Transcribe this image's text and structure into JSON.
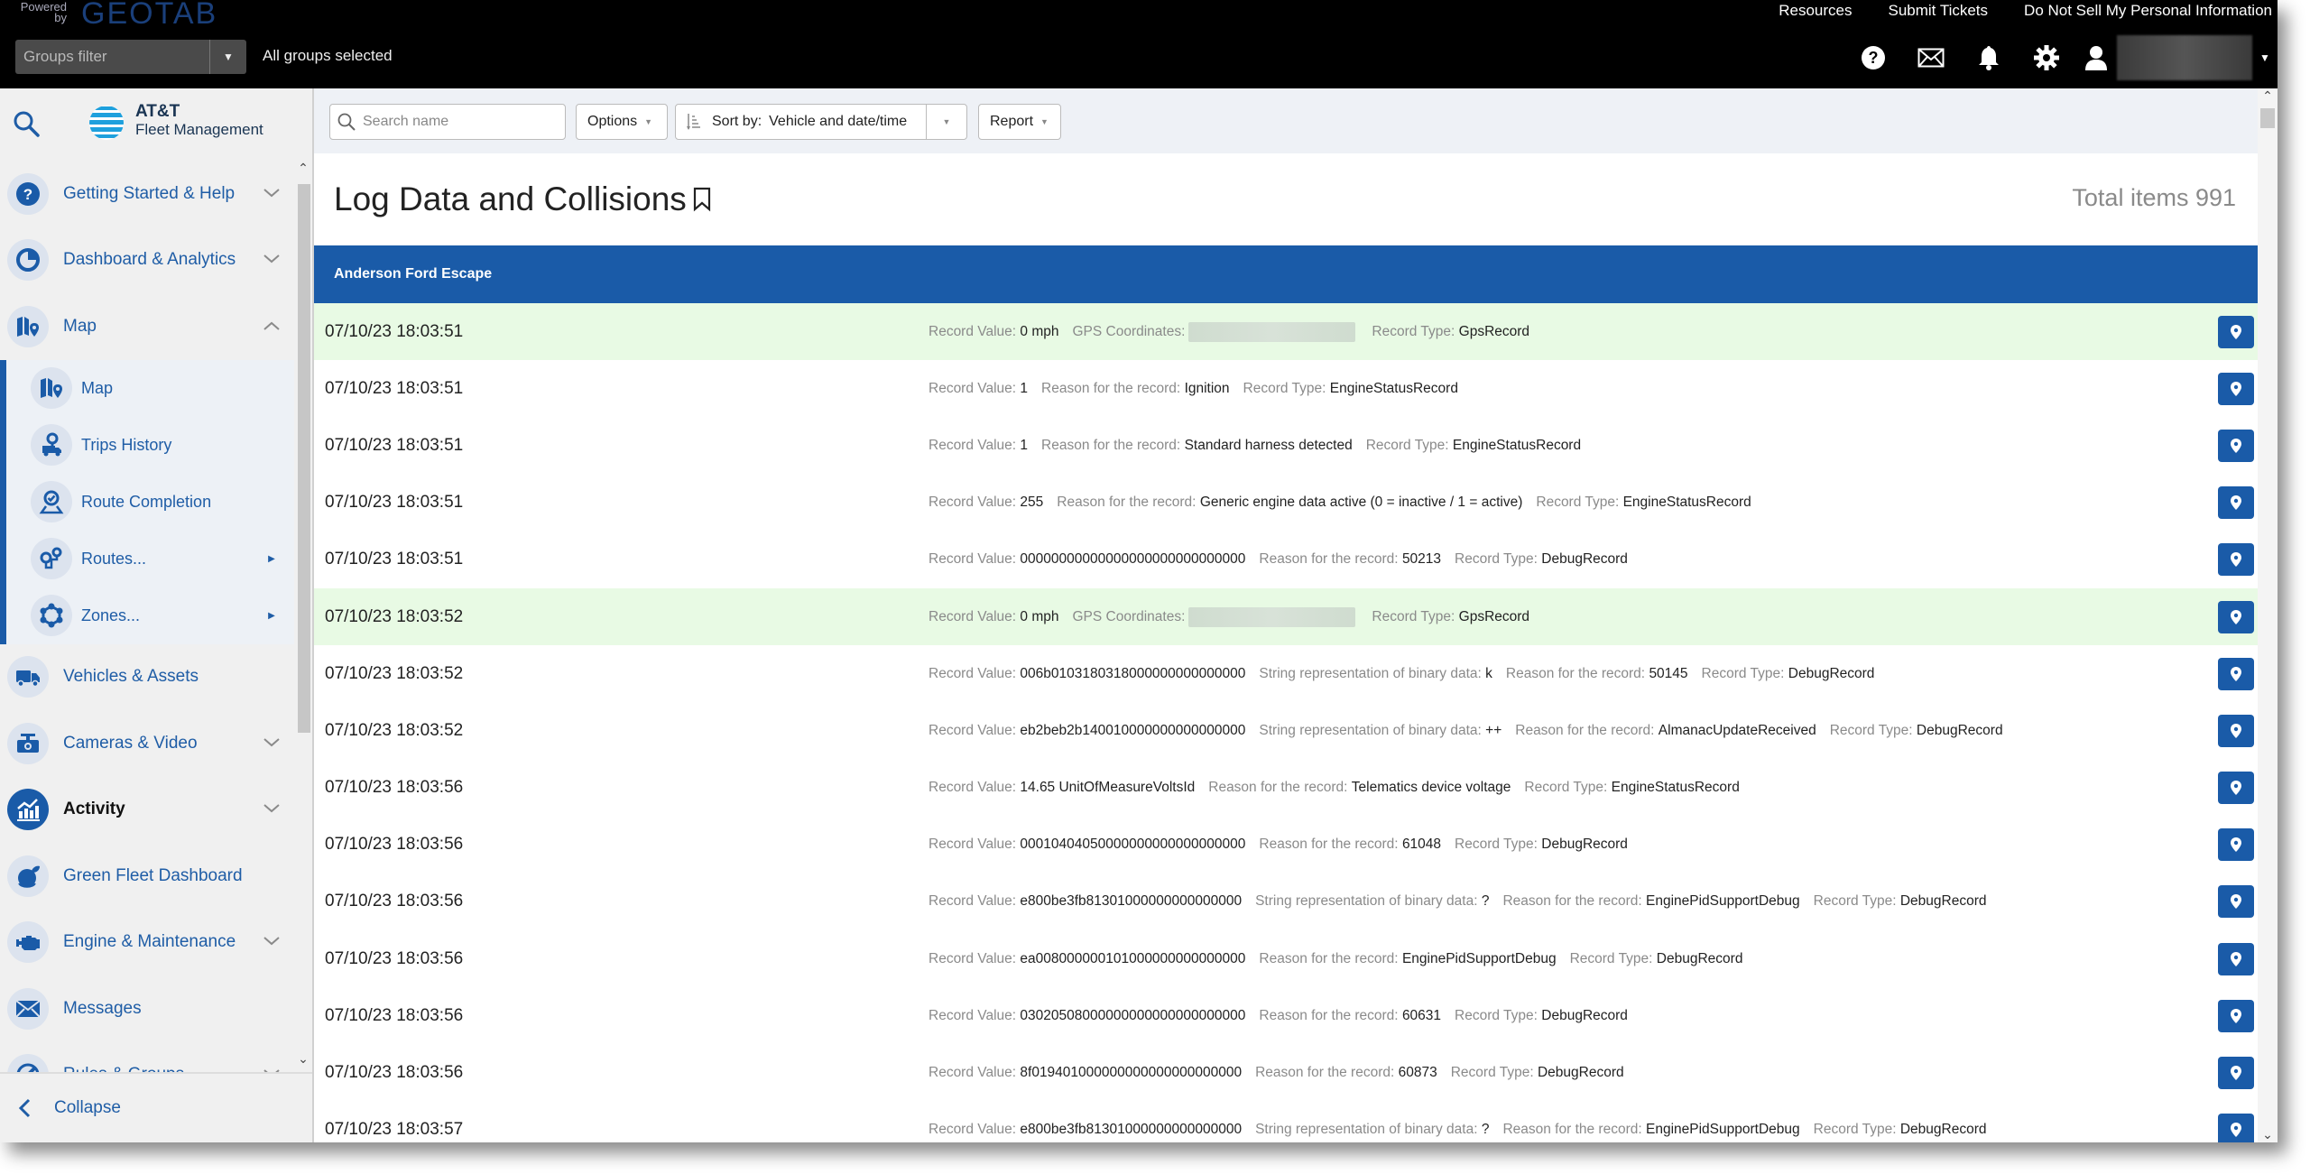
{
  "header": {
    "powered_by": "Powered by",
    "brand": "GEOTAB",
    "groups_filter_placeholder": "Groups filter",
    "groups_selected": "All groups selected",
    "links": [
      "Resources",
      "Submit Tickets",
      "Do Not Sell My Personal Information"
    ],
    "icons": [
      "help-icon",
      "mail-icon",
      "bell-icon",
      "gear-icon",
      "user-icon"
    ]
  },
  "sidebar": {
    "brand_line1": "AT&T",
    "brand_line2": "Fleet Management",
    "items": [
      {
        "label": "Getting Started & Help",
        "icon": "help-icon",
        "chevron": "down"
      },
      {
        "label": "Dashboard & Analytics",
        "icon": "pie-chart-icon",
        "chevron": "down"
      },
      {
        "label": "Map",
        "icon": "map-icon",
        "chevron": "up",
        "expanded": true
      },
      {
        "label": "Vehicles & Assets",
        "icon": "truck-icon"
      },
      {
        "label": "Cameras & Video",
        "icon": "camera-icon",
        "chevron": "down"
      },
      {
        "label": "Activity",
        "icon": "activity-chart-icon",
        "chevron": "down",
        "active": true
      },
      {
        "label": "Green Fleet Dashboard",
        "icon": "green-fleet-icon"
      },
      {
        "label": "Engine & Maintenance",
        "icon": "engine-icon",
        "chevron": "down"
      },
      {
        "label": "Messages",
        "icon": "mail-icon"
      },
      {
        "label": "Rules & Groups",
        "icon": "rules-icon",
        "chevron": "down"
      }
    ],
    "map_subitems": [
      {
        "label": "Map",
        "icon": "map-icon"
      },
      {
        "label": "Trips History",
        "icon": "trips-history-icon"
      },
      {
        "label": "Route Completion",
        "icon": "route-completion-icon"
      },
      {
        "label": "Routes...",
        "icon": "routes-icon",
        "arrow": true
      },
      {
        "label": "Zones...",
        "icon": "zones-icon",
        "arrow": true
      }
    ],
    "collapse_label": "Collapse"
  },
  "toolbar": {
    "search_placeholder": "Search name",
    "options_label": "Options",
    "sort_prefix": "Sort by:",
    "sort_value": "Vehicle and date/time",
    "report_label": "Report"
  },
  "page": {
    "title": "Log Data and Collisions",
    "total_items_label": "Total items 991"
  },
  "group": {
    "name": "Anderson Ford Escape"
  },
  "labels": {
    "record_value": "Record Value:",
    "gps_coordinates": "GPS Coordinates:",
    "reason": "Reason for the record:",
    "binary": "String representation of binary data:",
    "record_type": "Record Type:"
  },
  "colors": {
    "accent": "#1a5ba8",
    "gps_row": "#e8fae4",
    "label_gray": "#8a8a8a"
  },
  "rows": [
    {
      "timestamp": "07/10/23 18:03:51",
      "record_value": "0 mph",
      "gps": true,
      "record_type": "GpsRecord"
    },
    {
      "timestamp": "07/10/23 18:03:51",
      "record_value": "1",
      "reason": "Ignition",
      "record_type": "EngineStatusRecord"
    },
    {
      "timestamp": "07/10/23 18:03:51",
      "record_value": "1",
      "reason": "Standard harness detected",
      "record_type": "EngineStatusRecord"
    },
    {
      "timestamp": "07/10/23 18:03:51",
      "record_value": "255",
      "reason": "Generic engine data active (0 = inactive / 1 = active)",
      "record_type": "EngineStatusRecord"
    },
    {
      "timestamp": "07/10/23 18:03:51",
      "record_value": "00000000000000000000000000000",
      "reason": "50213",
      "record_type": "DebugRecord"
    },
    {
      "timestamp": "07/10/23 18:03:52",
      "record_value": "0 mph",
      "gps": true,
      "record_type": "GpsRecord"
    },
    {
      "timestamp": "07/10/23 18:03:52",
      "record_value": "006b0103180318000000000000000",
      "binary": "k",
      "reason": "50145",
      "record_type": "DebugRecord"
    },
    {
      "timestamp": "07/10/23 18:03:52",
      "record_value": "eb2beb2b140010000000000000000",
      "binary": "++",
      "reason": "AlmanacUpdateReceived",
      "record_type": "DebugRecord"
    },
    {
      "timestamp": "07/10/23 18:03:56",
      "record_value": "14.65 UnitOfMeasureVoltsId",
      "reason": "Telematics device voltage",
      "record_type": "EngineStatusRecord"
    },
    {
      "timestamp": "07/10/23 18:03:56",
      "record_value": "00010404050000000000000000000",
      "reason": "61048",
      "record_type": "DebugRecord"
    },
    {
      "timestamp": "07/10/23 18:03:56",
      "record_value": "e800be3fb81301000000000000000",
      "binary": "?",
      "reason": "EnginePidSupportDebug",
      "record_type": "DebugRecord"
    },
    {
      "timestamp": "07/10/23 18:03:56",
      "record_value": "ea008000000101000000000000000",
      "reason": "EnginePidSupportDebug",
      "record_type": "DebugRecord"
    },
    {
      "timestamp": "07/10/23 18:03:56",
      "record_value": "03020508000000000000000000000",
      "reason": "60631",
      "record_type": "DebugRecord"
    },
    {
      "timestamp": "07/10/23 18:03:56",
      "record_value": "8f019401000000000000000000000",
      "reason": "60873",
      "record_type": "DebugRecord"
    },
    {
      "timestamp": "07/10/23 18:03:57",
      "record_value": "e800be3fb81301000000000000000",
      "binary": "?",
      "reason": "EnginePidSupportDebug",
      "record_type": "DebugRecord"
    }
  ]
}
